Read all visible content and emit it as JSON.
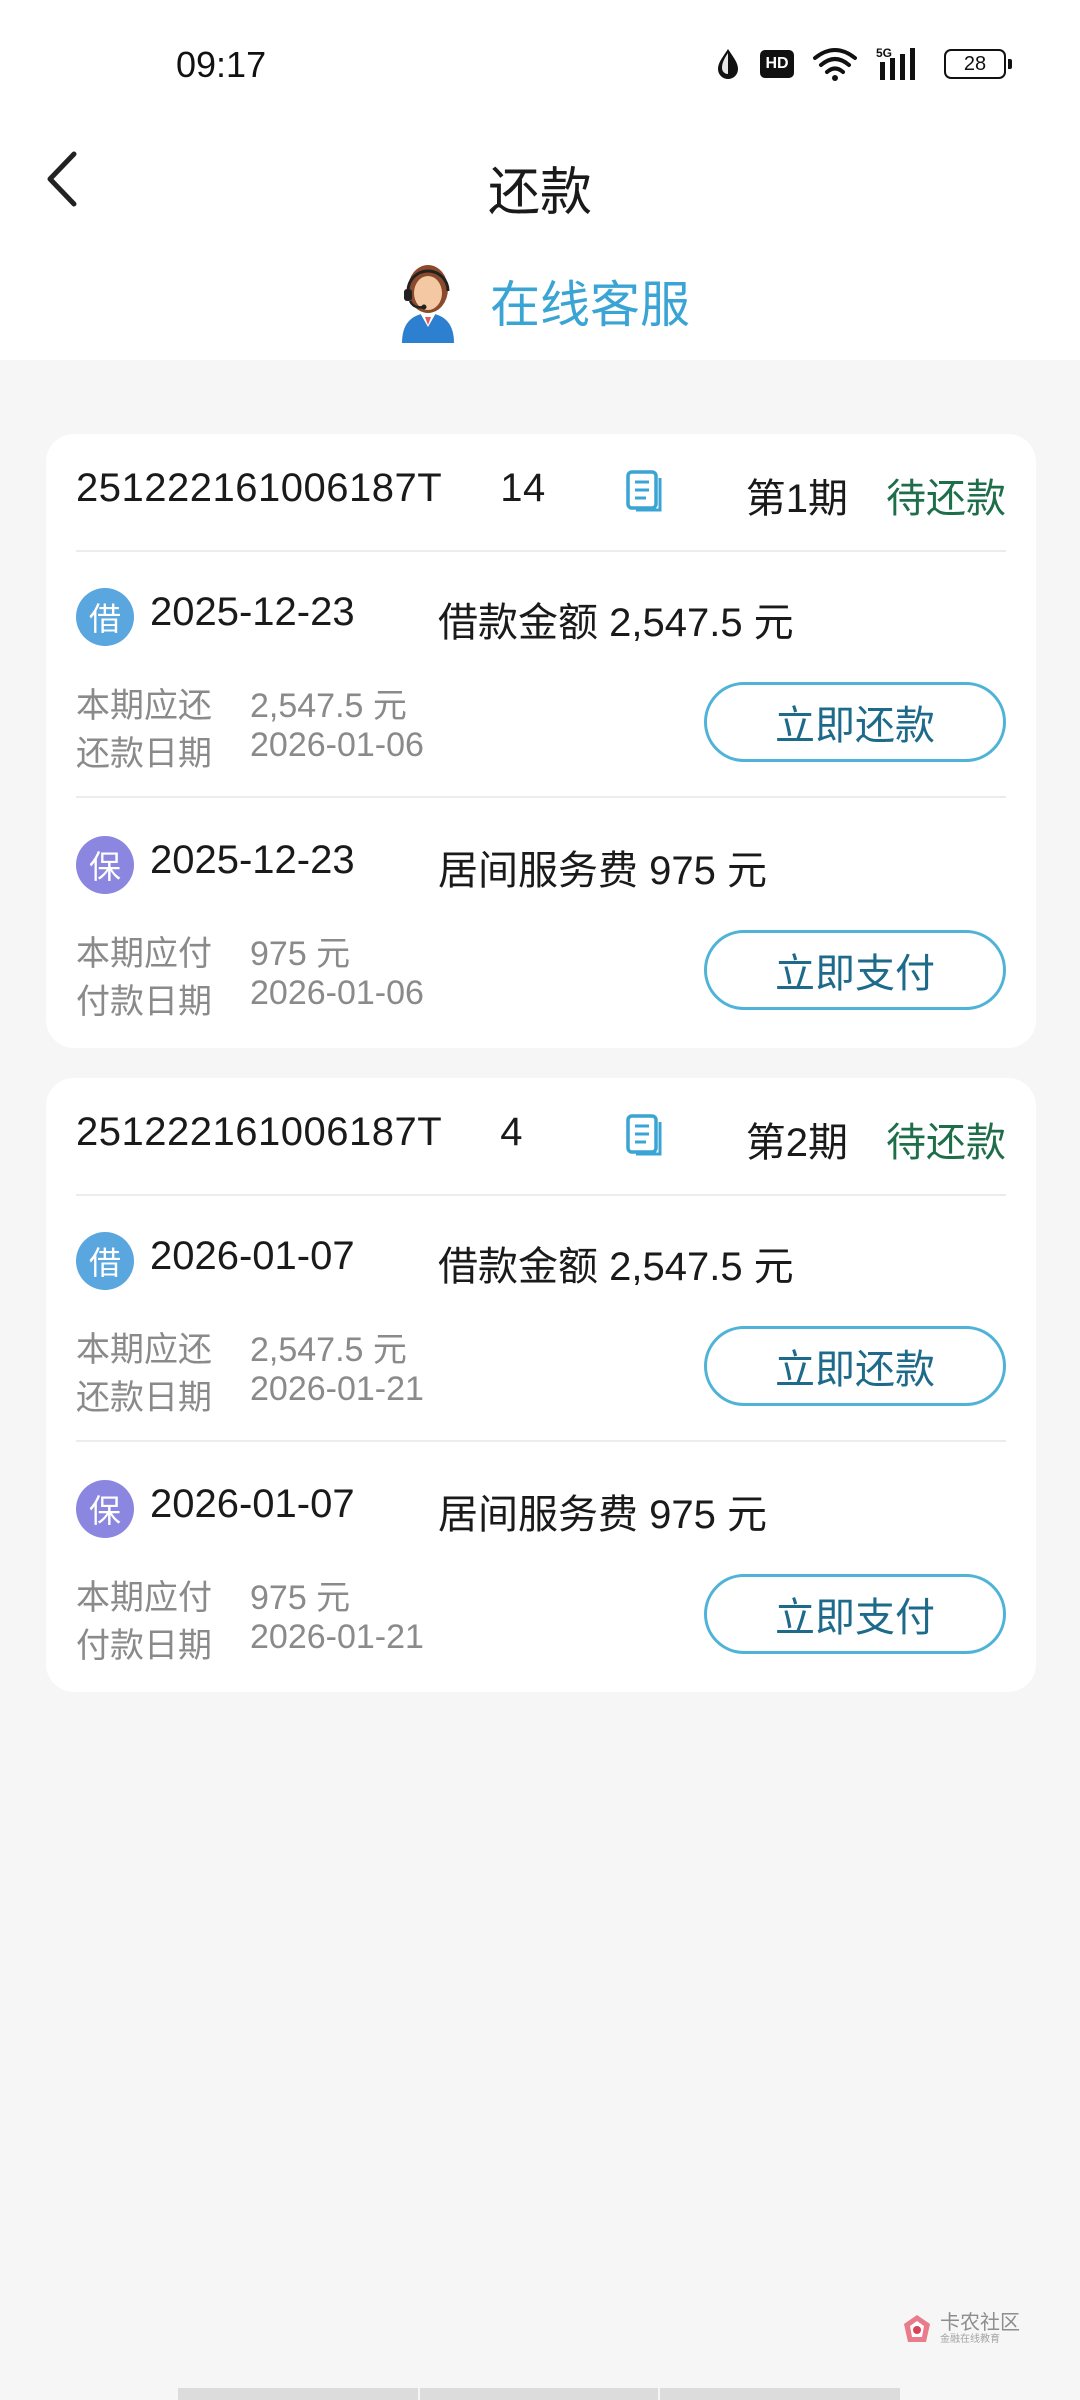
{
  "status_bar": {
    "time": "09:17",
    "hd_label": "HD",
    "signal_label": "5G",
    "battery_level": "28"
  },
  "nav": {
    "title": "还款"
  },
  "service": {
    "label": "在线客服"
  },
  "colors": {
    "accent": "#3aa4d4",
    "status_green": "#1f6e4a",
    "loan_badge": "#5aa6de",
    "fee_badge": "#8b86e0",
    "button_border": "#4eb3d6"
  },
  "cards": [
    {
      "order_no": "251222161006187T     14",
      "period": "第1期",
      "status": "待还款",
      "items": [
        {
          "badge": "借",
          "date": "2025-12-23",
          "desc": "借款金额 2,547.5 元",
          "row1_label": "本期应还",
          "row1_value": "2,547.5 元",
          "row2_label": "还款日期",
          "row2_value": "2026-01-06",
          "button": "立即还款"
        },
        {
          "badge": "保",
          "date": "2025-12-23",
          "desc": "居间服务费 975 元",
          "row1_label": "本期应付",
          "row1_value": "975 元",
          "row2_label": "付款日期",
          "row2_value": "2026-01-06",
          "button": "立即支付"
        }
      ]
    },
    {
      "order_no": "251222161006187T     4",
      "period": "第2期",
      "status": "待还款",
      "items": [
        {
          "badge": "借",
          "date": "2026-01-07",
          "desc": "借款金额 2,547.5 元",
          "row1_label": "本期应还",
          "row1_value": "2,547.5 元",
          "row2_label": "还款日期",
          "row2_value": "2026-01-21",
          "button": "立即还款"
        },
        {
          "badge": "保",
          "date": "2026-01-07",
          "desc": "居间服务费 975 元",
          "row1_label": "本期应付",
          "row1_value": "975 元",
          "row2_label": "付款日期",
          "row2_value": "2026-01-21",
          "button": "立即支付"
        }
      ]
    }
  ],
  "watermark": {
    "title": "卡农社区",
    "subtitle": "金融在线教育"
  }
}
